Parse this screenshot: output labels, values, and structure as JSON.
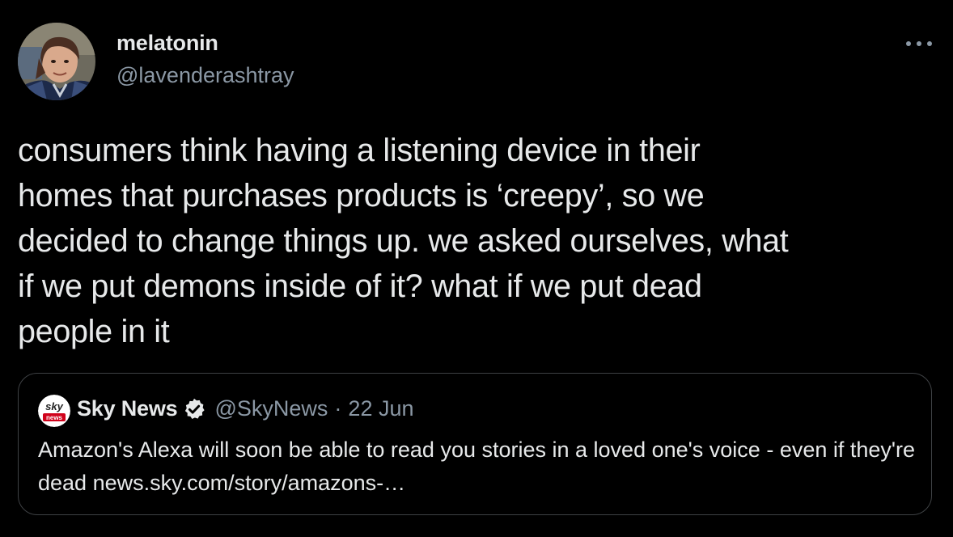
{
  "author": {
    "display_name": "melatonin",
    "handle": "@lavenderashtray",
    "avatar_icon": "profile-photo"
  },
  "more_icon": "more-dots-icon",
  "tweet": {
    "text": "consumers think having a listening device in their\nhomes that purchases products is ‘creepy’, so we\ndecided to change things up. we asked ourselves, what\nif we put demons inside of it? what if we put dead\npeople in it"
  },
  "quoted_tweet": {
    "avatar_logo": {
      "top_text": "sky",
      "bottom_text": "news"
    },
    "display_name": "Sky News",
    "verified_icon": "verified-badge-icon",
    "handle": "@SkyNews",
    "separator": "·",
    "date": "22 Jun",
    "text": "Amazon's Alexa will soon be able to read you stories in a loved one's voice - even if they're dead news.sky.com/story/amazons-…"
  },
  "colors": {
    "background": "#000000",
    "primary_text": "#e7e9ea",
    "secondary_text": "#8b98a5",
    "card_border": "#3e4144",
    "sky_red": "#d0021b"
  }
}
